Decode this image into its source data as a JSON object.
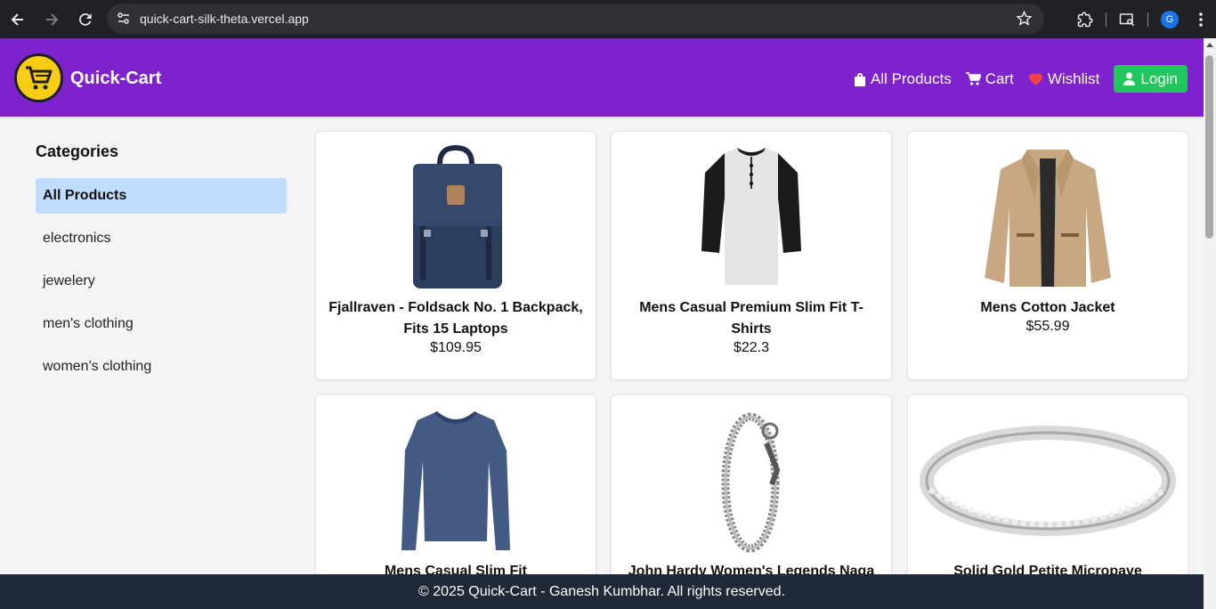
{
  "browser": {
    "url": "quick-cart-silk-theta.vercel.app",
    "profile_initial": "G"
  },
  "header": {
    "brand": "Quick-Cart",
    "nav": {
      "all_products": "All Products",
      "cart": "Cart",
      "wishlist": "Wishlist",
      "login": "Login"
    }
  },
  "sidebar": {
    "title": "Categories",
    "items": [
      {
        "label": "All Products",
        "active": true
      },
      {
        "label": "electronics",
        "active": false
      },
      {
        "label": "jewelery",
        "active": false
      },
      {
        "label": "men's clothing",
        "active": false
      },
      {
        "label": "women's clothing",
        "active": false
      }
    ]
  },
  "products": [
    {
      "title": "Fjallraven - Foldsack No. 1 Backpack, Fits 15 Laptops",
      "price": "$109.95",
      "image": "backpack"
    },
    {
      "title": "Mens Casual Premium Slim Fit T-Shirts",
      "price": "$22.3",
      "image": "tshirt"
    },
    {
      "title": "Mens Cotton Jacket",
      "price": "$55.99",
      "image": "jacket"
    },
    {
      "title": "Mens Casual Slim Fit",
      "price": "",
      "image": "longsleeve"
    },
    {
      "title": "John Hardy Women's Legends Naga",
      "price": "",
      "image": "bracelet"
    },
    {
      "title": "Solid Gold Petite Micropave",
      "price": "",
      "image": "ring"
    }
  ],
  "footer": {
    "text": "© 2025 Quick-Cart - Ganesh Kumbhar. All rights reserved."
  },
  "colors": {
    "header_bg": "#7e22ce",
    "login_bg": "#22c55e",
    "active_category_bg": "#bfdbfe",
    "footer_bg": "#1f2937",
    "wishlist_heart": "#ef4444"
  }
}
